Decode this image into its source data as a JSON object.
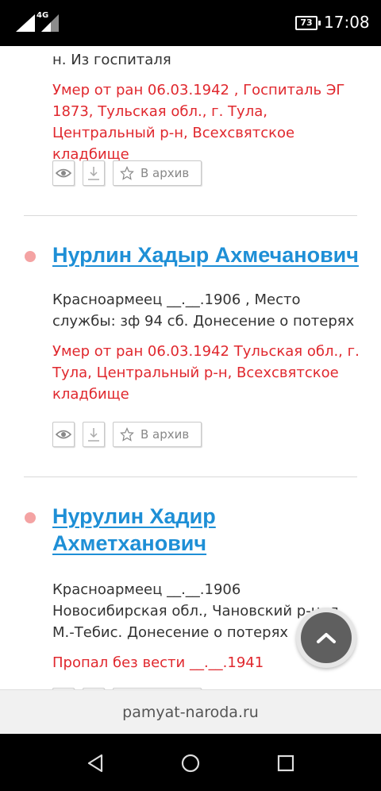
{
  "status_bar": {
    "network": "4G",
    "battery": "73",
    "time": "17:08"
  },
  "entries": [
    {
      "desc_partial": "н. Из госпиталя",
      "fate": "Умер от ран 06.03.1942 , Госпиталь ЭГ 1873, Тульская обл., г. Тула, Центральный р-н, Всехсвятское кладбище",
      "archive_label": "В архив"
    },
    {
      "name": "Нурлин Хадыр Ахмечанович",
      "desc": "Красноармеец __.__.1906 , Место службы: зф 94 сб. Донесение о потерях",
      "fate": "Умер от ран 06.03.1942 Тульская обл., г. Тула, Центральный р-н, Всехсвятское кладбище",
      "archive_label": "В архив"
    },
    {
      "name": "Нурулин Хадир Ахметханович",
      "desc": "Красноармеец __.__.1906 Новосибирская обл., Чановский р-н, д. М.-Тебис. Донесение о потерях",
      "fate": "Пропал без вести __.__.1941"
    }
  ],
  "url_bar": {
    "url": "pamyat-naroda.ru"
  },
  "icons": {
    "view": "eye-icon",
    "download": "download-icon",
    "archive": "star-icon",
    "scroll_up": "chevron-up-icon"
  },
  "colors": {
    "link": "#1e8fd6",
    "fate": "#e0282e",
    "bullet": "#f4a3a3"
  }
}
